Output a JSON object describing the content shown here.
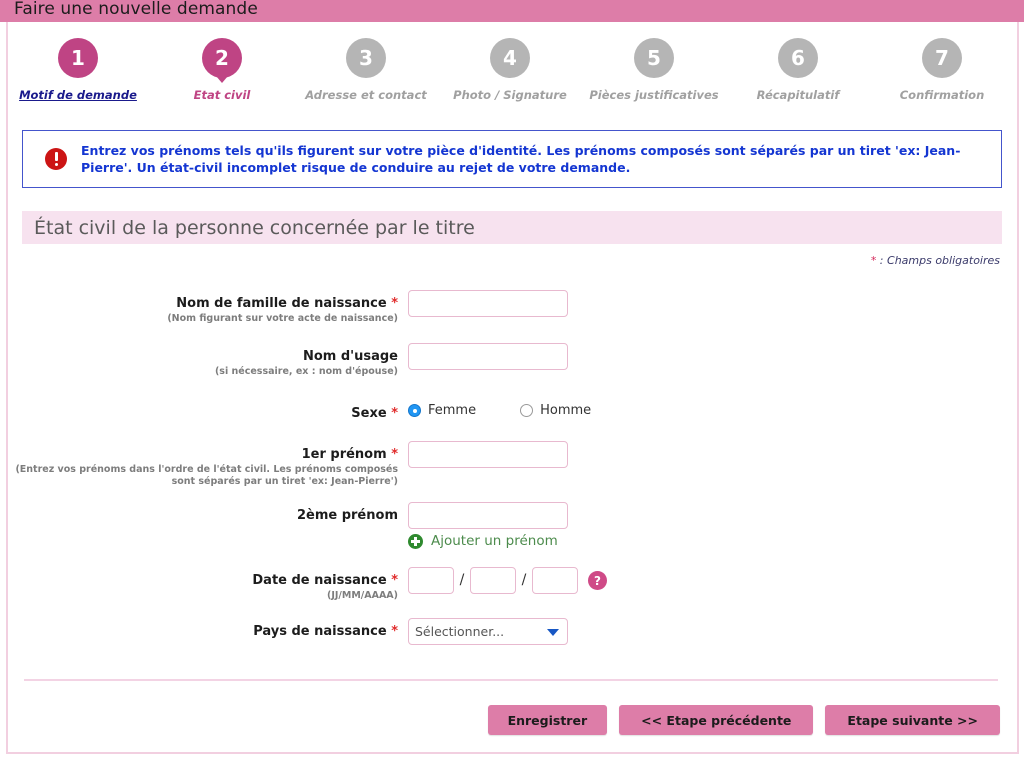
{
  "header": {
    "title": "Faire une nouvelle demande"
  },
  "stepper": {
    "steps": [
      {
        "number": "1",
        "label": "Motif de demande",
        "state": "done"
      },
      {
        "number": "2",
        "label": "Etat civil",
        "state": "current"
      },
      {
        "number": "3",
        "label": "Adresse et contact",
        "state": "todo"
      },
      {
        "number": "4",
        "label": "Photo / Signature",
        "state": "todo"
      },
      {
        "number": "5",
        "label": "Pièces justificatives",
        "state": "todo"
      },
      {
        "number": "6",
        "label": "Récapitulatif",
        "state": "todo"
      },
      {
        "number": "7",
        "label": "Confirmation",
        "state": "todo"
      }
    ]
  },
  "alert": {
    "icon": "error-icon",
    "text": "Entrez vos prénoms tels qu'ils figurent sur votre pièce d'identité. Les prénoms composés sont séparés par un tiret 'ex: Jean-Pierre'. Un état-civil incomplet risque de conduire au rejet de votre demande."
  },
  "section": {
    "title": "État civil de la personne concernée par le titre",
    "required_star": "*",
    "required_note": " : Champs obligatoires"
  },
  "form": {
    "nom_naissance": {
      "label": "Nom de famille de naissance ",
      "star": "*",
      "hint": "(Nom figurant sur votre acte de naissance)",
      "value": "",
      "placeholder": ""
    },
    "nom_usage": {
      "label": "Nom d'usage",
      "hint": "(si nécessaire, ex : nom d'épouse)",
      "value": "",
      "placeholder": ""
    },
    "sexe": {
      "label": "Sexe ",
      "star": "*",
      "options": [
        {
          "label": "Femme",
          "checked": true
        },
        {
          "label": "Homme",
          "checked": false
        }
      ]
    },
    "prenom1": {
      "label": "1er prénom ",
      "star": "*",
      "hint": "(Entrez vos prénoms dans l'ordre de l'état civil. Les prénoms composés sont séparés par un tiret 'ex: Jean-Pierre')",
      "value": "",
      "placeholder": ""
    },
    "prenom2": {
      "label": "2ème prénom",
      "value": "",
      "placeholder": ""
    },
    "add_prenom": {
      "icon": "plus-circle-icon",
      "label": "Ajouter un prénom"
    },
    "date_naissance": {
      "label": "Date de naissance ",
      "star": "*",
      "hint": "(JJ/MM/AAAA)",
      "day": "",
      "month": "",
      "year": "",
      "separator": "/",
      "help_icon_label": "?"
    },
    "pays_naissance": {
      "label": "Pays de naissance ",
      "star": "*",
      "selected": "Sélectionner...",
      "options": [
        "Sélectionner..."
      ]
    }
  },
  "actions": {
    "save": "Enregistrer",
    "previous": "<<  Etape précédente",
    "next": "Etape suivante  >>"
  }
}
